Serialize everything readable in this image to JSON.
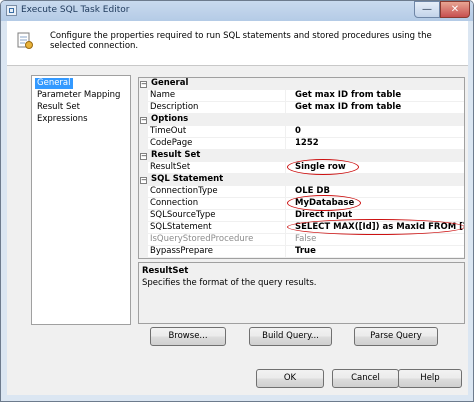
{
  "window": {
    "title": "Execute SQL Task Editor",
    "minimize_glyph": "—",
    "close_glyph": "✕"
  },
  "header": {
    "description": "Configure the properties required to run SQL statements and stored procedures using the selected connection.",
    "icon": "task-editor-icon"
  },
  "nav": {
    "items": [
      "General",
      "Parameter Mapping",
      "Result Set",
      "Expressions"
    ],
    "selected": "General"
  },
  "grid": {
    "rows": [
      {
        "category": "General"
      },
      {
        "name": "Name",
        "value": "Get max ID from table"
      },
      {
        "name": "Description",
        "value": "Get max ID from table"
      },
      {
        "category": "Options"
      },
      {
        "name": "TimeOut",
        "value": "0"
      },
      {
        "name": "CodePage",
        "value": "1252"
      },
      {
        "category": "Result Set"
      },
      {
        "name": "ResultSet",
        "value": "Single row"
      },
      {
        "category": "SQL Statement"
      },
      {
        "name": "ConnectionType",
        "value": "OLE DB"
      },
      {
        "name": "Connection",
        "value": "MyDatabase"
      },
      {
        "name": "SQLSourceType",
        "value": "Direct input"
      },
      {
        "name": "SQLStatement",
        "value": "SELECT MAX([Id]) as MaxId FROM [YourTable]"
      },
      {
        "name": "IsQueryStoredProcedure",
        "value": "False",
        "disabled": true
      },
      {
        "name": "BypassPrepare",
        "value": "True"
      }
    ],
    "expander_glyph": "−"
  },
  "help": {
    "title": "ResultSet",
    "text": "Specifies the format of the query results."
  },
  "buttons": {
    "browse": "Browse...",
    "build_query": "Build Query...",
    "parse_query": "Parse Query",
    "ok": "OK",
    "cancel": "Cancel",
    "help": "Help"
  },
  "colors": {
    "annotation": "#cc1111",
    "selection": "#3399ff"
  }
}
